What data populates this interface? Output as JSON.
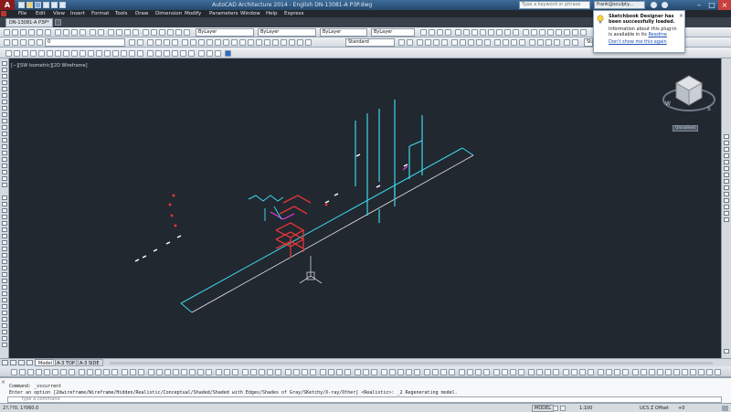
{
  "titlebar": {
    "title": "AutoCAD Architecture 2014 - English    DN-13081-A P3P.dwg",
    "search_placeholder": "Type a keyword or phrase",
    "user": "frank@sculpty..."
  },
  "menu": {
    "items": [
      "File",
      "Edit",
      "View",
      "Insert",
      "Format",
      "Tools",
      "Draw",
      "Dimension",
      "Modify",
      "Parameters",
      "Window",
      "Help",
      "Express"
    ]
  },
  "file_tab": {
    "label": "DN-13081-A P3P*"
  },
  "toolbar": {
    "layer_value": "0",
    "color_value": "ByLayer",
    "linetype_value": "ByLayer",
    "lineweight_value": "ByLayer",
    "plotstyle_value": "ByLayer",
    "style_value": "Standard",
    "dimstyle_value": "Standard",
    "annotation_value": "Standard"
  },
  "viewport": {
    "label": "[−][SW Isometric][2D Wireframe]"
  },
  "viewcube": {
    "face_label": "TOP",
    "unnamed_label": "Unnamed"
  },
  "layout_tabs": [
    "Model",
    "A-3 TOP",
    "A-3 SIDE"
  ],
  "command": {
    "line1": "Command: _vscurrent",
    "line2": "Enter an option [2dwireframe/Wireframe/Hidden/Realistic/Conceptual/Shaded/Shaded with Edges/Shades of Gray/SKetchy/X-ray/Other] <Realistic>: _2 Regenerating model.",
    "input_placeholder": "Type a command"
  },
  "status": {
    "coords": "2?,??0, 1?060.0",
    "model_label": "MODEL",
    "scale_label": "1:100",
    "ucs_label": "UCS Z Offset",
    "zoom_label": "+0"
  },
  "balloon": {
    "title": "Sketchbook Designer has been successfully loaded.",
    "body": "Information about this plug-in is available in its",
    "link": "Readme",
    "dismiss": "Don't show me this again"
  },
  "colors": {
    "canvas": "#212830",
    "cyan": "#3fd5e8",
    "red": "#e23535",
    "magenta": "#e23be0",
    "white": "#e6e6e6"
  }
}
